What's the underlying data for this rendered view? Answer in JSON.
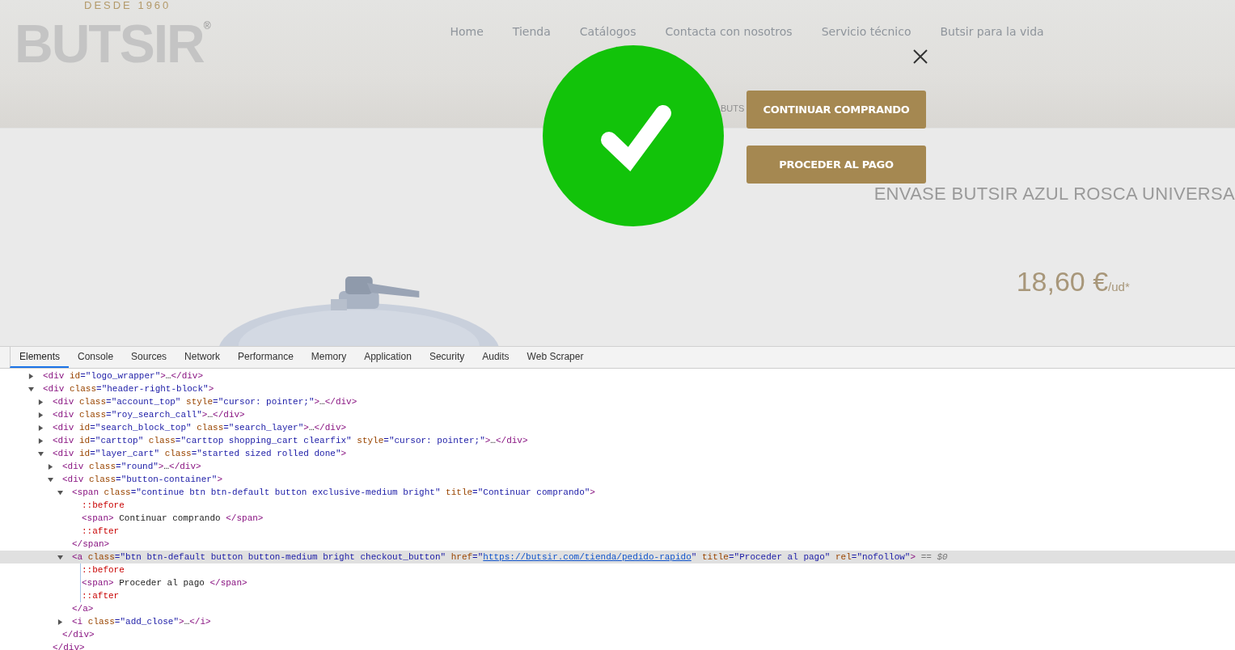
{
  "page": {
    "logo": {
      "tagline": "DESDE 1960",
      "name": "BUTSIR",
      "mark": "®"
    },
    "nav": [
      "Home",
      "Tienda",
      "Catálogos",
      "Contacta con nosotros",
      "Servicio técnico",
      "Butsir para la vida"
    ],
    "breadcrumb_fragment": "BUTS",
    "product": {
      "title": "ENVASE BUTSIR AZUL ROSCA UNIVERSA",
      "price": "18,60 €",
      "unit": "/ud*"
    }
  },
  "modal": {
    "buttons": [
      "CONTINUAR COMPRANDO",
      "PROCEDER AL PAGO"
    ]
  },
  "devtools": {
    "tabs": [
      {
        "label": "Elements",
        "selected": true
      },
      {
        "label": "Console",
        "selected": false
      },
      {
        "label": "Sources",
        "selected": false
      },
      {
        "label": "Network",
        "selected": false
      },
      {
        "label": "Performance",
        "selected": false
      },
      {
        "label": "Memory",
        "selected": false
      },
      {
        "label": "Application",
        "selected": false
      },
      {
        "label": "Security",
        "selected": false
      },
      {
        "label": "Audits",
        "selected": false
      },
      {
        "label": "Web Scraper",
        "selected": false
      }
    ],
    "dom_tree": [
      {
        "expanded": false,
        "selected": false,
        "parts": [
          {
            "kind": "tag",
            "text": "<div "
          },
          {
            "kind": "attr",
            "text": "id"
          },
          {
            "kind": "value",
            "text": "=\"logo_wrapper\""
          },
          {
            "kind": "tag",
            "text": ">"
          },
          {
            "kind": "text",
            "text": "…"
          },
          {
            "kind": "tag",
            "text": "</div>"
          }
        ]
      },
      {
        "expanded": true,
        "selected": false,
        "parts": [
          {
            "kind": "tag",
            "text": "<div "
          },
          {
            "kind": "attr",
            "text": "class"
          },
          {
            "kind": "value",
            "text": "=\"header-right-block\""
          },
          {
            "kind": "tag",
            "text": ">"
          }
        ],
        "children": [
          {
            "expanded": false,
            "selected": false,
            "parts": [
              {
                "kind": "tag",
                "text": "<div "
              },
              {
                "kind": "attr",
                "text": "class"
              },
              {
                "kind": "value",
                "text": "=\"account_top\" "
              },
              {
                "kind": "attr",
                "text": "style"
              },
              {
                "kind": "value",
                "text": "=\"cursor: pointer;\""
              },
              {
                "kind": "tag",
                "text": ">"
              },
              {
                "kind": "text",
                "text": "…"
              },
              {
                "kind": "tag",
                "text": "</div>"
              }
            ]
          },
          {
            "expanded": false,
            "selected": false,
            "parts": [
              {
                "kind": "tag",
                "text": "<div "
              },
              {
                "kind": "attr",
                "text": "class"
              },
              {
                "kind": "value",
                "text": "=\"roy_search_call\""
              },
              {
                "kind": "tag",
                "text": ">"
              },
              {
                "kind": "text",
                "text": "…"
              },
              {
                "kind": "tag",
                "text": "</div>"
              }
            ]
          },
          {
            "expanded": false,
            "selected": false,
            "parts": [
              {
                "kind": "tag",
                "text": "<div "
              },
              {
                "kind": "attr",
                "text": "id"
              },
              {
                "kind": "value",
                "text": "=\"search_block_top\" "
              },
              {
                "kind": "attr",
                "text": "class"
              },
              {
                "kind": "value",
                "text": "=\"search_layer\""
              },
              {
                "kind": "tag",
                "text": ">"
              },
              {
                "kind": "text",
                "text": "…"
              },
              {
                "kind": "tag",
                "text": "</div>"
              }
            ]
          },
          {
            "expanded": false,
            "selected": false,
            "parts": [
              {
                "kind": "tag",
                "text": "<div "
              },
              {
                "kind": "attr",
                "text": "id"
              },
              {
                "kind": "value",
                "text": "=\"carttop\" "
              },
              {
                "kind": "attr",
                "text": "class"
              },
              {
                "kind": "value",
                "text": "=\"carttop shopping_cart clearfix\" "
              },
              {
                "kind": "attr",
                "text": "style"
              },
              {
                "kind": "value",
                "text": "=\"cursor: pointer;\""
              },
              {
                "kind": "tag",
                "text": ">"
              },
              {
                "kind": "text",
                "text": "…"
              },
              {
                "kind": "tag",
                "text": "</div>"
              }
            ]
          },
          {
            "expanded": true,
            "selected": false,
            "parts": [
              {
                "kind": "tag",
                "text": "<div "
              },
              {
                "kind": "attr",
                "text": "id"
              },
              {
                "kind": "value",
                "text": "=\"layer_cart\" "
              },
              {
                "kind": "attr",
                "text": "class"
              },
              {
                "kind": "value",
                "text": "=\"started sized rolled done\""
              },
              {
                "kind": "tag",
                "text": ">"
              }
            ],
            "children": [
              {
                "expanded": false,
                "selected": false,
                "parts": [
                  {
                    "kind": "tag",
                    "text": "<div "
                  },
                  {
                    "kind": "attr",
                    "text": "class"
                  },
                  {
                    "kind": "value",
                    "text": "=\"round\""
                  },
                  {
                    "kind": "tag",
                    "text": ">"
                  },
                  {
                    "kind": "text",
                    "text": "…"
                  },
                  {
                    "kind": "tag",
                    "text": "</div>"
                  }
                ]
              },
              {
                "expanded": true,
                "selected": false,
                "parts": [
                  {
                    "kind": "tag",
                    "text": "<div "
                  },
                  {
                    "kind": "attr",
                    "text": "class"
                  },
                  {
                    "kind": "value",
                    "text": "=\"button-container\""
                  },
                  {
                    "kind": "tag",
                    "text": ">"
                  }
                ],
                "children": [
                  {
                    "expanded": true,
                    "selected": false,
                    "parts": [
                      {
                        "kind": "tag",
                        "text": "<span "
                      },
                      {
                        "kind": "attr",
                        "text": "class"
                      },
                      {
                        "kind": "value",
                        "text": "=\"continue btn btn-default button exclusive-medium bright\" "
                      },
                      {
                        "kind": "attr",
                        "text": "title"
                      },
                      {
                        "kind": "value",
                        "text": "=\"Continuar comprando\""
                      },
                      {
                        "kind": "tag",
                        "text": ">"
                      }
                    ],
                    "children": [
                      {
                        "selected": false,
                        "parts": [
                          {
                            "kind": "pseudo",
                            "text": "::before"
                          }
                        ]
                      },
                      {
                        "selected": false,
                        "parts": [
                          {
                            "kind": "tag",
                            "text": "<span>"
                          },
                          {
                            "kind": "text",
                            "text": " Continuar comprando "
                          },
                          {
                            "kind": "tag",
                            "text": "</span>"
                          }
                        ]
                      },
                      {
                        "selected": false,
                        "parts": [
                          {
                            "kind": "pseudo",
                            "text": "::after"
                          }
                        ]
                      }
                    ]
                  },
                  {
                    "selected": false,
                    "parts": [
                      {
                        "kind": "tag",
                        "text": "</span>"
                      }
                    ]
                  },
                  {
                    "expanded": true,
                    "selected": true,
                    "parts": [
                      {
                        "kind": "tag",
                        "text": "<a "
                      },
                      {
                        "kind": "attr",
                        "text": "class"
                      },
                      {
                        "kind": "value",
                        "text": "=\"btn btn-default button button-medium bright checkout_button\" "
                      },
                      {
                        "kind": "attr",
                        "text": "href"
                      },
                      {
                        "kind": "value",
                        "text": "=\""
                      },
                      {
                        "kind": "link",
                        "text": "https://butsir.com/tienda/pedido-rapido"
                      },
                      {
                        "kind": "value",
                        "text": "\" "
                      },
                      {
                        "kind": "attr",
                        "text": "title"
                      },
                      {
                        "kind": "value",
                        "text": "=\"Proceder al pago\" "
                      },
                      {
                        "kind": "attr",
                        "text": "rel"
                      },
                      {
                        "kind": "value",
                        "text": "=\"nofollow\""
                      },
                      {
                        "kind": "tag",
                        "text": ">"
                      },
                      {
                        "kind": "dim",
                        "text": " == $0"
                      }
                    ],
                    "children": [
                      {
                        "selected": false,
                        "parts": [
                          {
                            "kind": "pseudo",
                            "text": "::before"
                          }
                        ]
                      },
                      {
                        "selected": false,
                        "parts": [
                          {
                            "kind": "tag",
                            "text": "<span>"
                          },
                          {
                            "kind": "text",
                            "text": " Proceder al pago "
                          },
                          {
                            "kind": "tag",
                            "text": "</span>"
                          }
                        ]
                      },
                      {
                        "selected": false,
                        "parts": [
                          {
                            "kind": "pseudo",
                            "text": "::after"
                          }
                        ]
                      }
                    ]
                  },
                  {
                    "selected": false,
                    "parts": [
                      {
                        "kind": "tag",
                        "text": "</a>"
                      }
                    ]
                  },
                  {
                    "expanded": false,
                    "selected": false,
                    "parts": [
                      {
                        "kind": "tag",
                        "text": "<i "
                      },
                      {
                        "kind": "attr",
                        "text": "class"
                      },
                      {
                        "kind": "value",
                        "text": "=\"add_close\""
                      },
                      {
                        "kind": "tag",
                        "text": ">"
                      },
                      {
                        "kind": "text",
                        "text": "…"
                      },
                      {
                        "kind": "tag",
                        "text": "</i>"
                      }
                    ]
                  }
                ]
              },
              {
                "selected": false,
                "parts": [
                  {
                    "kind": "tag",
                    "text": "</div>"
                  }
                ]
              }
            ]
          },
          {
            "selected": false,
            "parts": [
              {
                "kind": "tag",
                "text": "</div>"
              }
            ]
          }
        ]
      }
    ]
  }
}
